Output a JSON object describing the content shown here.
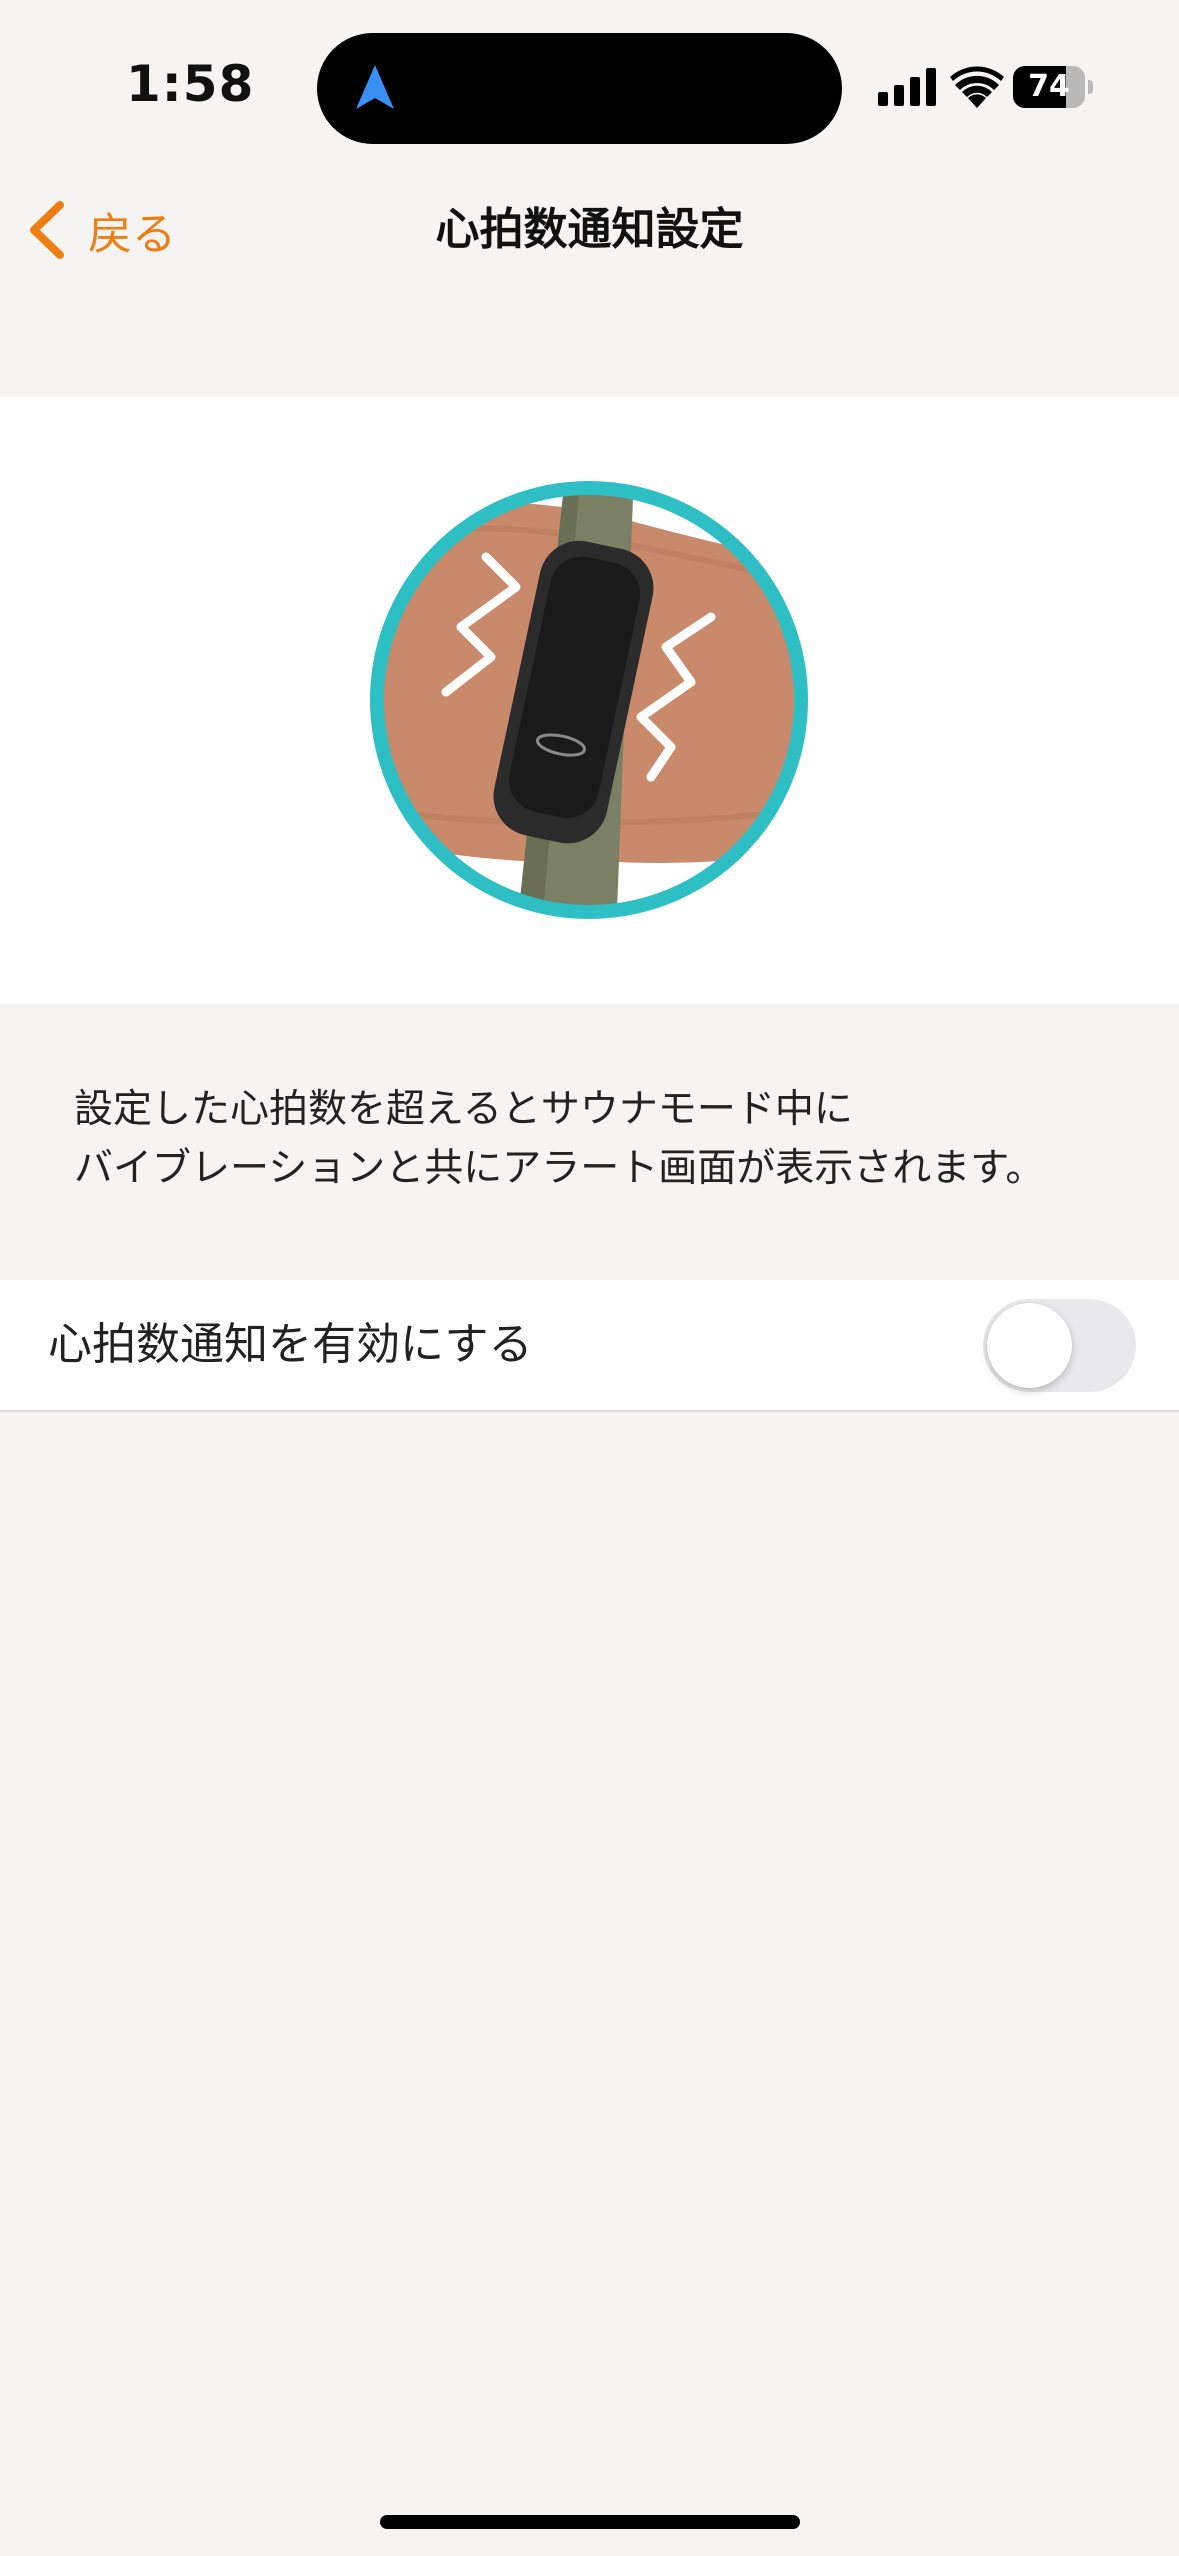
{
  "status_bar": {
    "time": "1:58",
    "battery": "74",
    "battery_level": 0.74,
    "icons": [
      "location-arrow-icon",
      "cellular-signal-icon",
      "wifi-icon",
      "battery-icon"
    ]
  },
  "nav": {
    "back_label": "戻る",
    "title": "心拍数通知設定",
    "accent_color": "#f07d12"
  },
  "hero": {
    "image": "wristband-vibration-illustration",
    "ring_color": "#2ebfc4"
  },
  "description": {
    "line1": "設定した心拍数を超えるとサウナモード中に",
    "line2": "バイブレーションと共にアラート画面が表示されます。"
  },
  "settings": {
    "toggle_label": "心拍数通知を有効にする",
    "toggle_on": false
  }
}
